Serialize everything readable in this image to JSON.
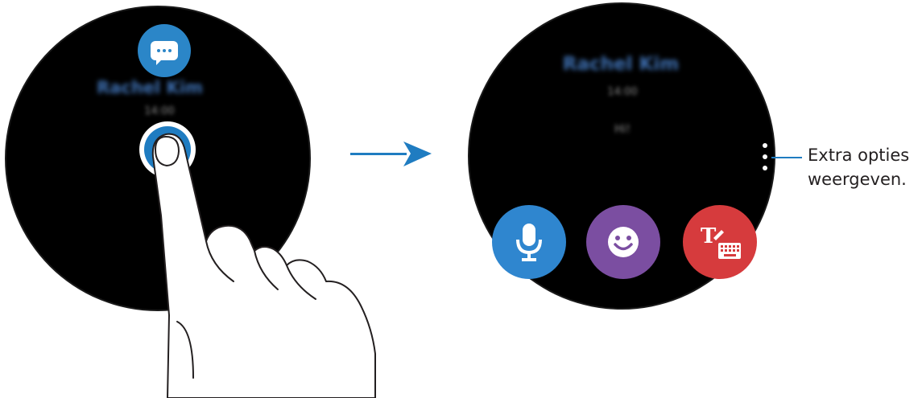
{
  "left_screen": {
    "app_icon": "message-bubble-icon",
    "sender_name": "Rachel Kim",
    "sender_sub": "14:00",
    "tap_target": "touch-point-indicator"
  },
  "transition_arrow": "arrow-right-icon",
  "right_screen": {
    "sender_name": "Rachel Kim",
    "time": "14:00",
    "message": "Hi!",
    "more_options_icon": "more-options-icon",
    "actions": [
      {
        "name": "voice-input",
        "icon": "microphone-icon",
        "color": "#2f86cf"
      },
      {
        "name": "emoji",
        "icon": "smiley-icon",
        "color": "#7b4ea1"
      },
      {
        "name": "keyboard-input",
        "icon": "keyboard-text-icon",
        "color": "#d63b3d"
      }
    ]
  },
  "callout": {
    "line1": "Extra opties",
    "line2": "weergeven."
  },
  "colors": {
    "accent_blue": "#1f7cc1",
    "watch_bg": "#000000"
  }
}
